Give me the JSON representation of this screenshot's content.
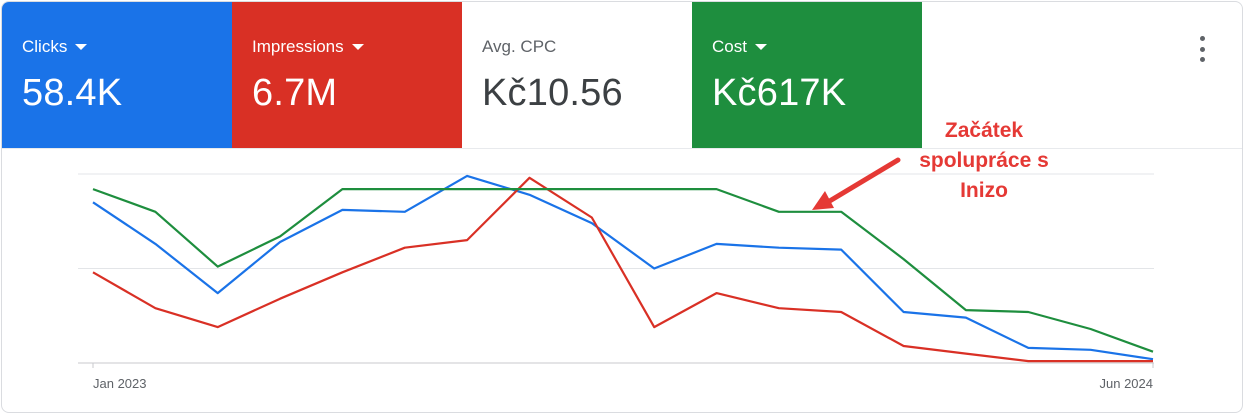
{
  "metrics": [
    {
      "id": "clicks",
      "label": "Clicks",
      "value": "58.4K",
      "has_dropdown": true,
      "color": "#1a73e8"
    },
    {
      "id": "impr",
      "label": "Impressions",
      "value": "6.7M",
      "has_dropdown": true,
      "color": "#d93025"
    },
    {
      "id": "cpc",
      "label": "Avg. CPC",
      "value": "Kč10.56",
      "has_dropdown": false,
      "color": "#ffffff"
    },
    {
      "id": "cost",
      "label": "Cost",
      "value": "Kč617K",
      "has_dropdown": true,
      "color": "#1e8e3e"
    }
  ],
  "menu_icon": "more-vert-icon",
  "annotation": {
    "text": "Začátek\nspolupráce s\nInizo",
    "color": "#e53935",
    "arrow_icon": "arrow-icon"
  },
  "chart_data": {
    "type": "line",
    "grid": true,
    "x_ticks": [
      "Jan 2023",
      "Jun 2024"
    ],
    "ylim": [
      0,
      100
    ],
    "y_gridlines": [
      0,
      50,
      100
    ],
    "points": 18,
    "series": [
      {
        "metric": "Clicks",
        "color": "#1a73e8",
        "values": [
          85,
          63,
          37,
          64,
          81,
          80,
          99,
          89,
          74,
          50,
          63,
          61,
          60,
          27,
          24,
          8,
          7,
          2
        ]
      },
      {
        "metric": "Impressions",
        "color": "#d93025",
        "values": [
          48,
          29,
          19,
          34,
          48,
          61,
          65,
          98,
          77,
          19,
          37,
          29,
          27,
          9,
          5,
          1,
          1,
          1
        ]
      },
      {
        "metric": "Cost",
        "color": "#1e8e3e",
        "values": [
          92,
          80,
          51,
          67,
          92,
          92,
          92,
          92,
          92,
          92,
          92,
          80,
          80,
          55,
          28,
          27,
          18,
          6
        ]
      }
    ]
  }
}
